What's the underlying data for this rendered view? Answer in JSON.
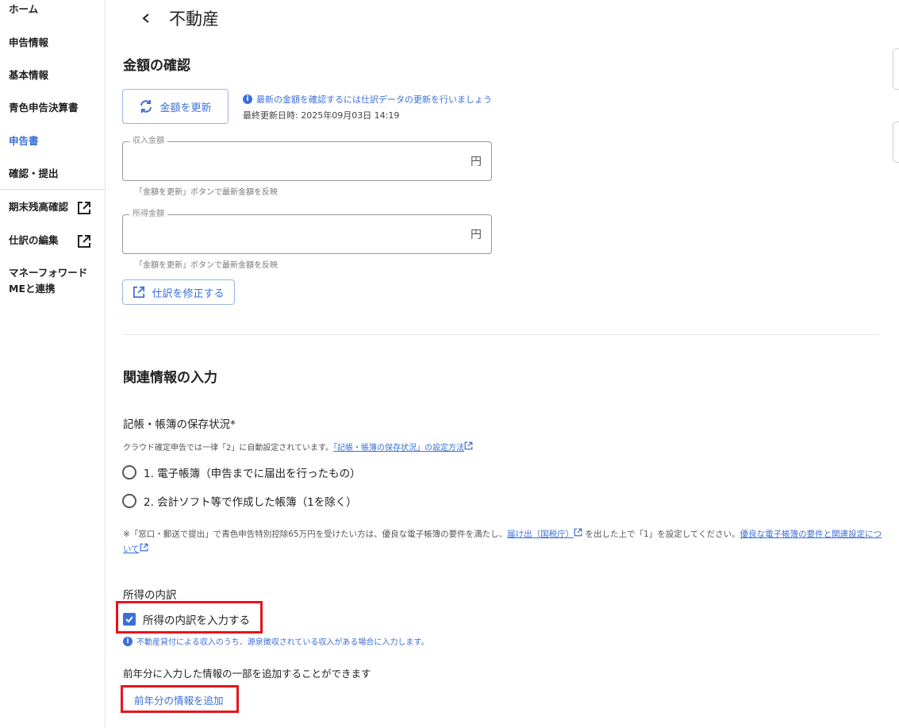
{
  "sidebar": {
    "items": [
      {
        "label": "ホーム"
      },
      {
        "label": "申告情報"
      },
      {
        "label": "基本情報"
      },
      {
        "label": "青色申告決算書"
      },
      {
        "label": "申告書"
      },
      {
        "label": "確認・提出"
      },
      {
        "label": "期末残高確認"
      },
      {
        "label": "仕訳の編集"
      },
      {
        "label": "マネーフォワード"
      },
      {
        "label": "MEと連携"
      }
    ],
    "active_color": "#3b6fd8"
  },
  "page": {
    "title": "不動産"
  },
  "amount_section": {
    "title": "金額の確認",
    "refresh_button": "金額を更新",
    "info_text": "最新の金額を確認するには仕訳データの更新を行いましょう",
    "last_updated": "最終更新日時: 2025年09月03日 14:19",
    "income_field": {
      "label": "収入金額",
      "value": "",
      "unit": "円",
      "helper": "「金額を更新」ボタンで最新金額を反映"
    },
    "profit_field": {
      "label": "所得金額",
      "value": "",
      "unit": "円",
      "helper": "「金額を更新」ボタンで最新金額を反映"
    },
    "fix_button": "仕訳を修正する"
  },
  "related_section": {
    "title": "関連情報の入力",
    "bookkeeping": {
      "label": "記帳・帳簿の保存状況*",
      "note_prefix": "クラウド確定申告では一律「2」に自動設定されています。",
      "note_link": "「記帳・帳簿の保存状況」の設定方法",
      "options": [
        "1. 電子帳簿（申告までに届出を行ったもの）",
        "2. 会計ソフト等で作成した帳簿（1を除く）"
      ],
      "long_note_1": "※「窓口・郵送で提出」で青色申告特別控除65万円を受けたい方は、優良な電子帳簿の要件を満たし、",
      "long_note_link_1": "届け出（国税庁）",
      "long_note_2": "を出した上で「1」を設定してください。",
      "long_note_link_2": "優良な電子帳簿の要件と関連設定について"
    },
    "breakdown": {
      "label": "所得の内訳",
      "checkbox_label": "所得の内訳を入力する",
      "checked": true,
      "info": "不動産貸付による収入のうち、源泉徴収されている収入がある場合に入力します。"
    },
    "prior_year": {
      "text": "前年分に入力した情報の一部を追加することができます",
      "button": "前年分の情報を追加"
    }
  },
  "colors": {
    "accent": "#3b6fd8",
    "highlight": "#e8131c"
  }
}
